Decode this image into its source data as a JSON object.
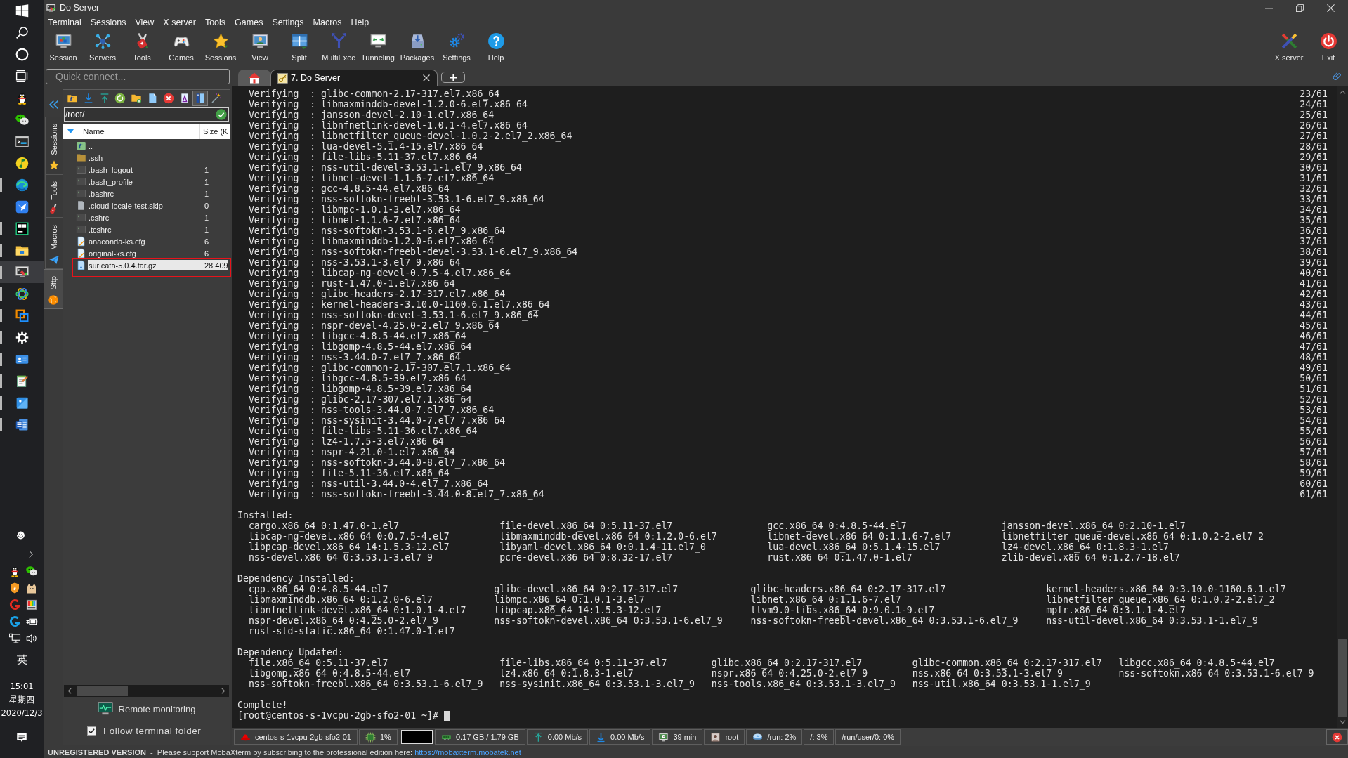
{
  "taskbar": {
    "apps": [
      {
        "kind": "penguin",
        "running": false,
        "selected": false
      },
      {
        "kind": "chat",
        "running": false,
        "selected": false
      },
      {
        "kind": "console",
        "running": false,
        "selected": false
      },
      {
        "kind": "disc",
        "running": false,
        "selected": false
      },
      {
        "kind": "browser",
        "running": true,
        "selected": false
      },
      {
        "kind": "bird",
        "running": false,
        "selected": false
      },
      {
        "kind": "editor",
        "running": true,
        "selected": false
      },
      {
        "kind": "folder",
        "running": true,
        "selected": false
      },
      {
        "kind": "terminal",
        "running": true,
        "selected": true
      },
      {
        "kind": "rings",
        "running": true,
        "selected": false
      },
      {
        "kind": "squares",
        "running": true,
        "selected": false
      },
      {
        "kind": "gear",
        "running": true,
        "selected": false
      },
      {
        "kind": "card",
        "running": true,
        "selected": false
      },
      {
        "kind": "notepad",
        "running": true,
        "selected": false
      },
      {
        "kind": "picture",
        "running": true,
        "selected": false
      },
      {
        "kind": "document",
        "running": true,
        "selected": false
      }
    ],
    "input_method": "英",
    "clock": {
      "time": "15:01",
      "weekday": "星期四",
      "date": "2020/12/3"
    }
  },
  "window": {
    "title": "Do Server"
  },
  "menu": [
    "Terminal",
    "Sessions",
    "View",
    "X server",
    "Tools",
    "Games",
    "Settings",
    "Macros",
    "Help"
  ],
  "toolbar": {
    "buttons": [
      {
        "label": "Session",
        "kind": "session"
      },
      {
        "label": "Servers",
        "kind": "servers"
      },
      {
        "label": "Tools",
        "kind": "tools"
      },
      {
        "label": "Games",
        "kind": "games"
      },
      {
        "label": "Sessions",
        "kind": "sessions"
      },
      {
        "label": "View",
        "kind": "view"
      },
      {
        "label": "Split",
        "kind": "split"
      },
      {
        "label": "MultiExec",
        "kind": "multiexec"
      },
      {
        "label": "Tunneling",
        "kind": "tunneling"
      },
      {
        "label": "Packages",
        "kind": "packages"
      },
      {
        "label": "Settings",
        "kind": "settings"
      },
      {
        "label": "Help",
        "kind": "help"
      }
    ],
    "right_buttons": [
      {
        "label": "X server",
        "kind": "xserver"
      },
      {
        "label": "Exit",
        "kind": "exit"
      }
    ]
  },
  "quick_connect": {
    "placeholder": "Quick connect..."
  },
  "tabs": [
    {
      "kind": "home",
      "selected": false
    },
    {
      "kind": "session",
      "label": "7. Do Server",
      "selected": true
    }
  ],
  "side_tabs": [
    {
      "label": "Sessions",
      "kind": "star",
      "selected": false
    },
    {
      "label": "Tools",
      "kind": "knife",
      "selected": false
    },
    {
      "label": "Macros",
      "kind": "plane",
      "selected": false
    },
    {
      "label": "Sftp",
      "kind": "globe",
      "selected": true
    }
  ],
  "sftp": {
    "toolbar": [
      {
        "kind": "parent",
        "selected": false
      },
      {
        "kind": "download",
        "selected": false
      },
      {
        "kind": "upload",
        "selected": false
      },
      {
        "kind": "refresh",
        "selected": false
      },
      {
        "kind": "newfolder",
        "selected": false
      },
      {
        "kind": "newfile",
        "selected": false
      },
      {
        "kind": "delete",
        "selected": false
      },
      {
        "kind": "rename",
        "selected": false
      },
      {
        "kind": "splitview",
        "selected": true
      },
      {
        "kind": "wand",
        "selected": false
      }
    ],
    "path": "/root/",
    "columns": [
      "Name",
      "Size (K"
    ],
    "files": [
      {
        "kind": "parent",
        "name": "..",
        "selected": false,
        "marked": false
      },
      {
        "kind": "folder",
        "name": ".ssh",
        "selected": false,
        "marked": false
      },
      {
        "kind": "script",
        "name": ".bash_logout",
        "size": "1",
        "selected": false,
        "marked": false
      },
      {
        "kind": "script",
        "name": ".bash_profile",
        "size": "1",
        "selected": false,
        "marked": false
      },
      {
        "kind": "script",
        "name": ".bashrc",
        "size": "1",
        "selected": false,
        "marked": false
      },
      {
        "kind": "blank",
        "name": ".cloud-locale-test.skip",
        "size": "0",
        "selected": false,
        "marked": false
      },
      {
        "kind": "script",
        "name": ".cshrc",
        "size": "1",
        "selected": false,
        "marked": false
      },
      {
        "kind": "script",
        "name": ".tcshrc",
        "size": "1",
        "selected": false,
        "marked": false
      },
      {
        "kind": "document",
        "name": "anaconda-ks.cfg",
        "size": "6",
        "selected": false,
        "marked": false
      },
      {
        "kind": "document",
        "name": "original-ks.cfg",
        "size": "6",
        "selected": false,
        "marked": false
      },
      {
        "kind": "archive",
        "name": "suricata-5.0.4.tar.gz",
        "size": "28 409",
        "selected": true,
        "marked": true
      }
    ],
    "remote_monitoring": "Remote monitoring",
    "follow_terminal_folder": {
      "label": "Follow terminal folder",
      "checked": true
    }
  },
  "terminal": {
    "verify_lines": [
      {
        "text": "Verifying  : glibc-common-2.17-317.el7.x86_64",
        "progress": "23/61"
      },
      {
        "text": "Verifying  : libmaxminddb-devel-1.2.0-6.el7.x86_64",
        "progress": "24/61"
      },
      {
        "text": "Verifying  : jansson-devel-2.10-1.el7.x86_64",
        "progress": "25/61"
      },
      {
        "text": "Verifying  : libnfnetlink-devel-1.0.1-4.el7.x86_64",
        "progress": "26/61"
      },
      {
        "text": "Verifying  : libnetfilter_queue-devel-1.0.2-2.el7_2.x86_64",
        "progress": "27/61"
      },
      {
        "text": "Verifying  : lua-devel-5.1.4-15.el7.x86_64",
        "progress": "28/61"
      },
      {
        "text": "Verifying  : file-libs-5.11-37.el7.x86_64",
        "progress": "29/61"
      },
      {
        "text": "Verifying  : nss-util-devel-3.53.1-1.el7_9.x86_64",
        "progress": "30/61"
      },
      {
        "text": "Verifying  : libnet-devel-1.1.6-7.el7.x86_64",
        "progress": "31/61"
      },
      {
        "text": "Verifying  : gcc-4.8.5-44.el7.x86_64",
        "progress": "32/61"
      },
      {
        "text": "Verifying  : nss-softokn-freebl-3.53.1-6.el7_9.x86_64",
        "progress": "33/61"
      },
      {
        "text": "Verifying  : libmpc-1.0.1-3.el7.x86_64",
        "progress": "34/61"
      },
      {
        "text": "Verifying  : libnet-1.1.6-7.el7.x86_64",
        "progress": "35/61"
      },
      {
        "text": "Verifying  : nss-softokn-3.53.1-6.el7_9.x86_64",
        "progress": "36/61"
      },
      {
        "text": "Verifying  : libmaxminddb-1.2.0-6.el7.x86_64",
        "progress": "37/61"
      },
      {
        "text": "Verifying  : nss-softokn-freebl-devel-3.53.1-6.el7_9.x86_64",
        "progress": "38/61"
      },
      {
        "text": "Verifying  : nss-3.53.1-3.el7_9.x86_64",
        "progress": "39/61"
      },
      {
        "text": "Verifying  : libcap-ng-devel-0.7.5-4.el7.x86_64",
        "progress": "40/61"
      },
      {
        "text": "Verifying  : rust-1.47.0-1.el7.x86_64",
        "progress": "41/61"
      },
      {
        "text": "Verifying  : glibc-headers-2.17-317.el7.x86_64",
        "progress": "42/61"
      },
      {
        "text": "Verifying  : kernel-headers-3.10.0-1160.6.1.el7.x86_64",
        "progress": "43/61"
      },
      {
        "text": "Verifying  : nss-softokn-devel-3.53.1-6.el7_9.x86_64",
        "progress": "44/61"
      },
      {
        "text": "Verifying  : nspr-devel-4.25.0-2.el7_9.x86_64",
        "progress": "45/61"
      },
      {
        "text": "Verifying  : libgcc-4.8.5-44.el7.x86_64",
        "progress": "46/61"
      },
      {
        "text": "Verifying  : libgomp-4.8.5-44.el7.x86_64",
        "progress": "47/61"
      },
      {
        "text": "Verifying  : nss-3.44.0-7.el7_7.x86_64",
        "progress": "48/61"
      },
      {
        "text": "Verifying  : glibc-common-2.17-307.el7.1.x86_64",
        "progress": "49/61"
      },
      {
        "text": "Verifying  : libgcc-4.8.5-39.el7.x86_64",
        "progress": "50/61"
      },
      {
        "text": "Verifying  : libgomp-4.8.5-39.el7.x86_64",
        "progress": "51/61"
      },
      {
        "text": "Verifying  : glibc-2.17-307.el7.1.x86_64",
        "progress": "52/61"
      },
      {
        "text": "Verifying  : nss-tools-3.44.0-7.el7_7.x86_64",
        "progress": "53/61"
      },
      {
        "text": "Verifying  : nss-sysinit-3.44.0-7.el7_7.x86_64",
        "progress": "54/61"
      },
      {
        "text": "Verifying  : file-libs-5.11-36.el7.x86_64",
        "progress": "55/61"
      },
      {
        "text": "Verifying  : lz4-1.7.5-3.el7.x86_64",
        "progress": "56/61"
      },
      {
        "text": "Verifying  : nspr-4.21.0-1.el7.x86_64",
        "progress": "57/61"
      },
      {
        "text": "Verifying  : nss-softokn-3.44.0-8.el7_7.x86_64",
        "progress": "58/61"
      },
      {
        "text": "Verifying  : file-5.11-36.el7.x86_64",
        "progress": "59/61"
      },
      {
        "text": "Verifying  : nss-util-3.44.0-4.el7_7.x86_64",
        "progress": "60/61"
      },
      {
        "text": "Verifying  : nss-softokn-freebl-3.44.0-8.el7_7.x86_64",
        "progress": "61/61"
      }
    ],
    "sections": [
      {
        "heading": "Installed:",
        "rows": [
          [
            "cargo.x86_64 0:1.47.0-1.el7",
            "file-devel.x86_64 0:5.11-37.el7",
            "gcc.x86_64 0:4.8.5-44.el7",
            "jansson-devel.x86_64 0:2.10-1.el7"
          ],
          [
            "libcap-ng-devel.x86_64 0:0.7.5-4.el7",
            "libmaxminddb-devel.x86_64 0:1.2.0-6.el7",
            "libnet-devel.x86_64 0:1.1.6-7.el7",
            "libnetfilter_queue-devel.x86_64 0:1.0.2-2.el7_2"
          ],
          [
            "libpcap-devel.x86_64 14:1.5.3-12.el7",
            "libyaml-devel.x86_64 0:0.1.4-11.el7_0",
            "lua-devel.x86_64 0:5.1.4-15.el7",
            "lz4-devel.x86_64 0:1.8.3-1.el7"
          ],
          [
            "nss-devel.x86_64 0:3.53.1-3.el7_9",
            "pcre-devel.x86_64 0:8.32-17.el7",
            "rust.x86_64 0:1.47.0-1.el7",
            "zlib-devel.x86_64 0:1.2.7-18.el7"
          ]
        ]
      },
      {
        "heading": "Dependency Installed:",
        "rows": [
          [
            "cpp.x86_64 0:4.8.5-44.el7",
            "glibc-devel.x86_64 0:2.17-317.el7",
            "glibc-headers.x86_64 0:2.17-317.el7",
            "kernel-headers.x86_64 0:3.10.0-1160.6.1.el7"
          ],
          [
            "libmaxminddb.x86_64 0:1.2.0-6.el7",
            "libmpc.x86_64 0:1.0.1-3.el7",
            "libnet.x86_64 0:1.1.6-7.el7",
            "libnetfilter_queue.x86_64 0:1.0.2-2.el7_2"
          ],
          [
            "libnfnetlink-devel.x86_64 0:1.0.1-4.el7",
            "libpcap.x86_64 14:1.5.3-12.el7",
            "llvm9.0-libs.x86_64 0:9.0.1-9.el7",
            "mpfr.x86_64 0:3.1.1-4.el7"
          ],
          [
            "nspr-devel.x86_64 0:4.25.0-2.el7_9",
            "nss-softokn-devel.x86_64 0:3.53.1-6.el7_9",
            "nss-softokn-freebl-devel.x86_64 0:3.53.1-6.el7_9",
            "nss-util-devel.x86_64 0:3.53.1-1.el7_9"
          ],
          [
            "rust-std-static.x86_64 0:1.47.0-1.el7"
          ]
        ]
      },
      {
        "heading": "Dependency Updated:",
        "rows": [
          [
            "file.x86_64 0:5.11-37.el7",
            "file-libs.x86_64 0:5.11-37.el7",
            "glibc.x86_64 0:2.17-317.el7",
            "glibc-common.x86_64 0:2.17-317.el7",
            "libgcc.x86_64 0:4.8.5-44.el7"
          ],
          [
            "libgomp.x86_64 0:4.8.5-44.el7",
            "lz4.x86_64 0:1.8.3-1.el7",
            "nspr.x86_64 0:4.25.0-2.el7_9",
            "nss.x86_64 0:3.53.1-3.el7_9",
            "nss-softokn.x86_64 0:3.53.1-6.el7_9"
          ],
          [
            "nss-softokn-freebl.x86_64 0:3.53.1-6.el7_9",
            "nss-sysinit.x86_64 0:3.53.1-3.el7_9",
            "nss-tools.x86_64 0:3.53.1-3.el7_9",
            "nss-util.x86_64 0:3.53.1-1.el7_9"
          ]
        ]
      }
    ],
    "result": "Complete!",
    "prompt": "[root@centos-s-1vcpu-2gb-sfo2-01 ~]#"
  },
  "status_bar": {
    "items": [
      {
        "kind": "os",
        "text": "centos-s-1vcpu-2gb-sfo2-01"
      },
      {
        "kind": "cpu",
        "text": "1%"
      },
      {
        "kind": "memory",
        "text": "0.17 GB / 1.79 GB"
      },
      {
        "kind": "upload",
        "text": "0.00 Mb/s"
      },
      {
        "kind": "download",
        "text": "0.00 Mb/s"
      },
      {
        "kind": "uptime",
        "text": "39 min"
      },
      {
        "kind": "user",
        "text": "root"
      },
      {
        "kind": "disk",
        "text": "/run: 2%"
      },
      {
        "kind": "plain",
        "text": "/: 3%"
      },
      {
        "kind": "plain",
        "text": "/run/user/0: 0%"
      }
    ]
  },
  "footer": {
    "notice": "**UNREGISTERED VERSION**  -  Please support MobaXterm by subscribing to the professional edition here: ",
    "link": "https://mobaxterm.mobatek.net"
  }
}
